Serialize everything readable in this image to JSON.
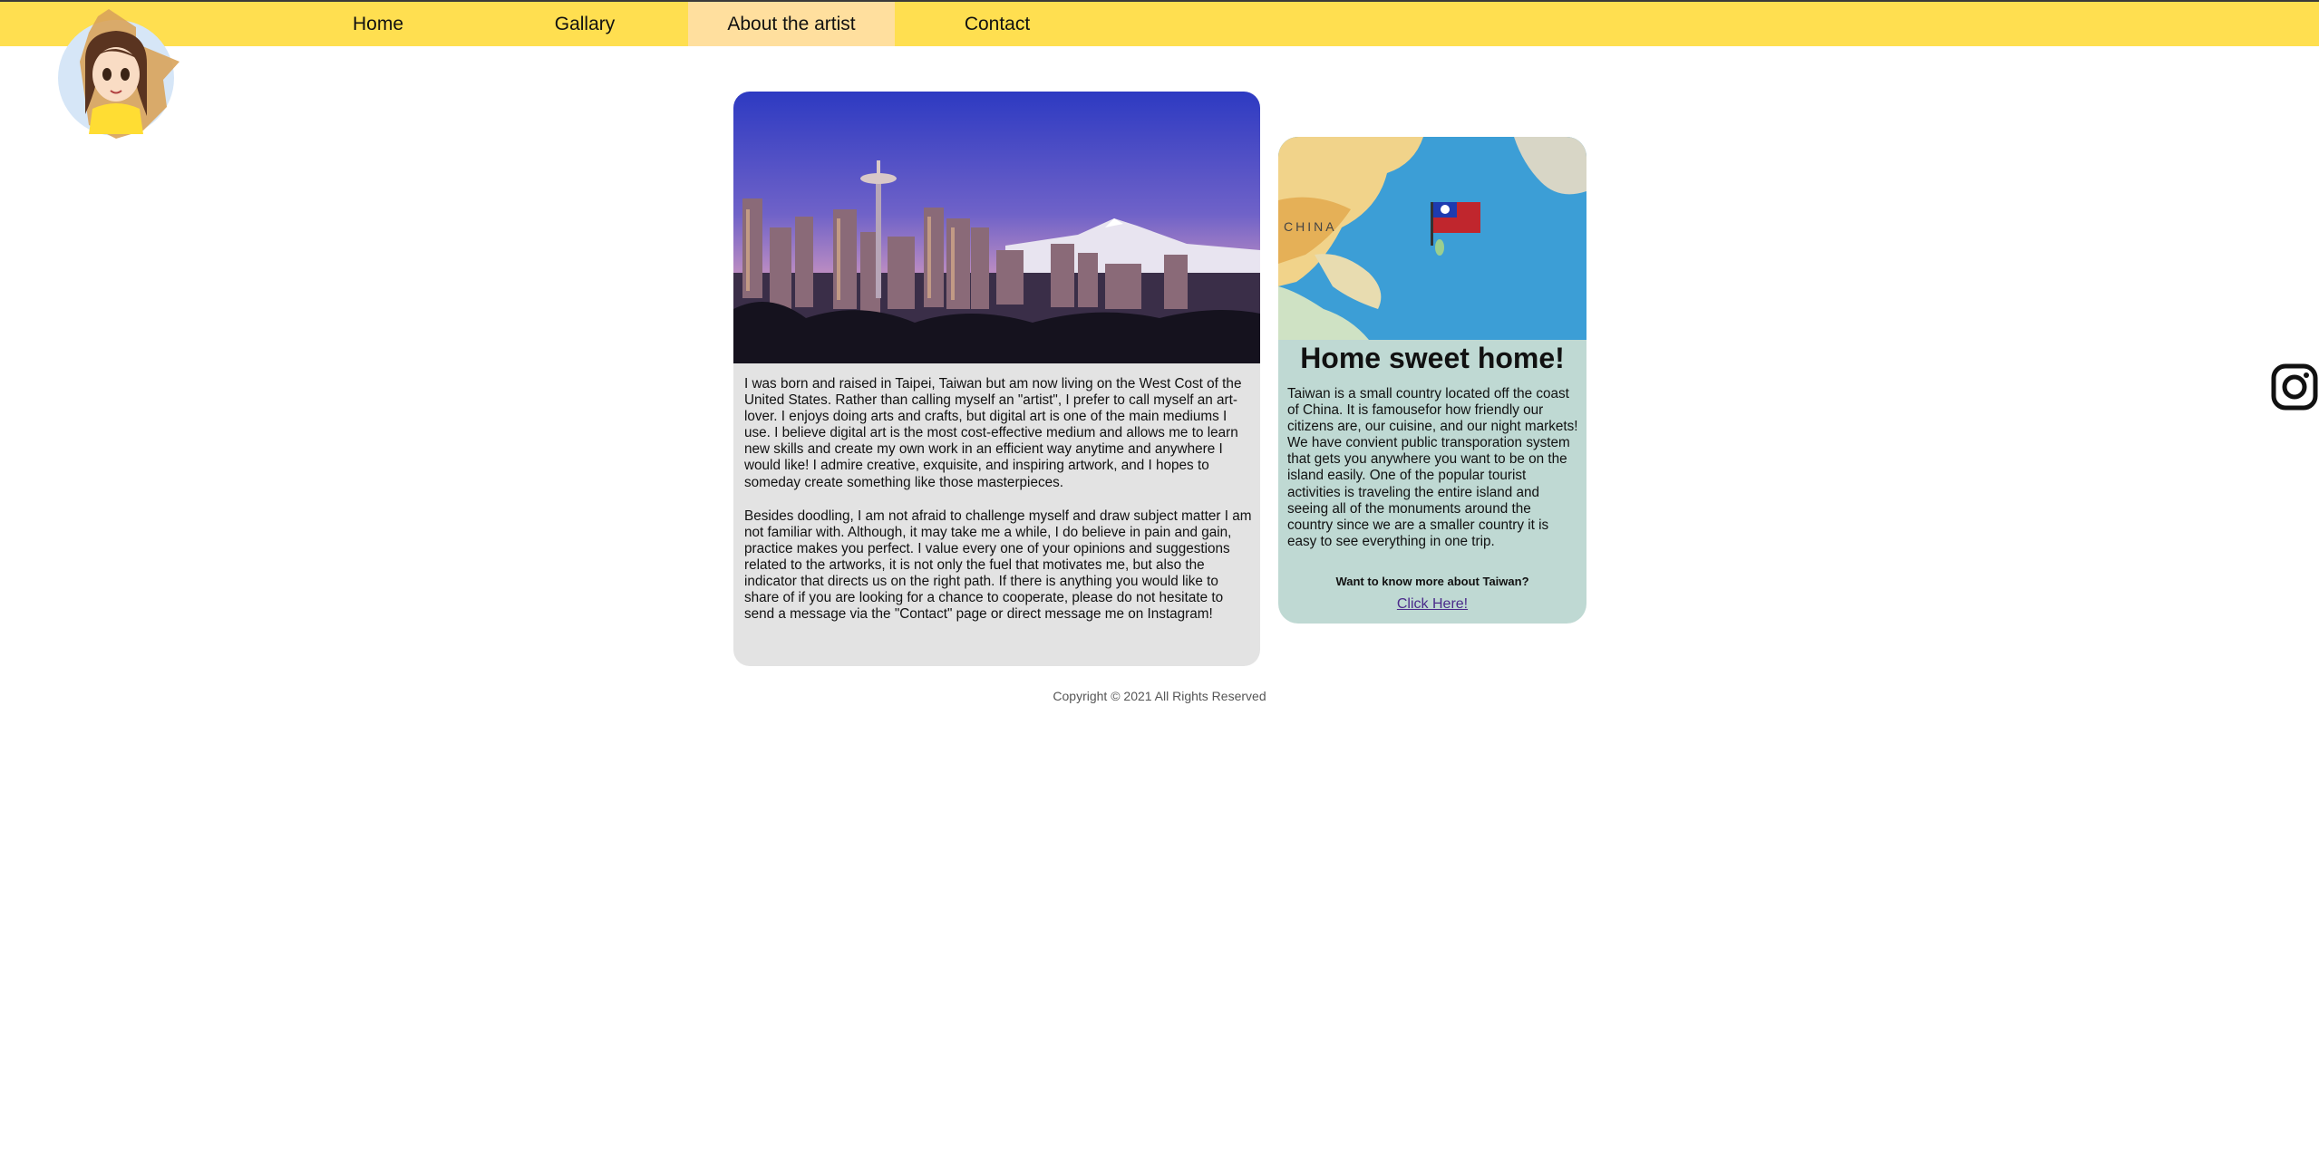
{
  "nav": {
    "items": [
      {
        "label": "Home",
        "active": false
      },
      {
        "label": "Gallary",
        "active": false
      },
      {
        "label": "About the artist",
        "active": true
      },
      {
        "label": "Contact",
        "active": false
      }
    ],
    "bar_color": "#ffdf50",
    "active_color": "#ffdf9e"
  },
  "avatar": {
    "icon": "artist-avatar-logo"
  },
  "about": {
    "photo": "seattle-skyline-photo",
    "paragraphs": [
      "I was born and raised in Taipei, Taiwan but am now living on the West Cost of the United States. Rather than calling myself an \"artist\", I prefer to call myself an art-lover. I enjoys doing arts and crafts, but digital art is one of the main mediums I use. I believe digital art is the most cost-effective medium and allows me to learn new skills and create my own work in an efficient way anytime and anywhere I would like! I admire creative, exquisite, and inspiring artwork, and I hopes to someday create something like those masterpieces.",
      "Besides doodling, I am not afraid to challenge myself and draw subject matter I am not familiar with. Although, it may take me a while, I do believe in pain and gain, practice makes you perfect. I value every one of your opinions and suggestions related to the artworks, it is not only the fuel that motivates me, but also the indicator that directs us on the right path. If there is anything you would like to share of if you are looking for a chance to cooperate, please do not hesitate to send a message via the \"Contact\" page or direct message me on Instagram!"
    ]
  },
  "taiwan": {
    "map": "taiwan-map-photo",
    "map_label": "CHINA",
    "title": "Home sweet home!",
    "body": "Taiwan is a small country located off the coast of China. It is famousefor how friendly our citizens are, our cuisine, and our night markets! We have convient public transporation system that gets you anywhere you want to be on the island easily. One of the popular tourist activities is traveling the entire island and seeing all of the monuments around the country since we are a smaller country it is easy to see everything in one trip.",
    "question": "Want to know more about Taiwan?",
    "link": "Click Here!"
  },
  "footer": {
    "copyright": "Copyright © 2021 All Rights Reserved"
  },
  "social": {
    "icon": "instagram-icon"
  }
}
